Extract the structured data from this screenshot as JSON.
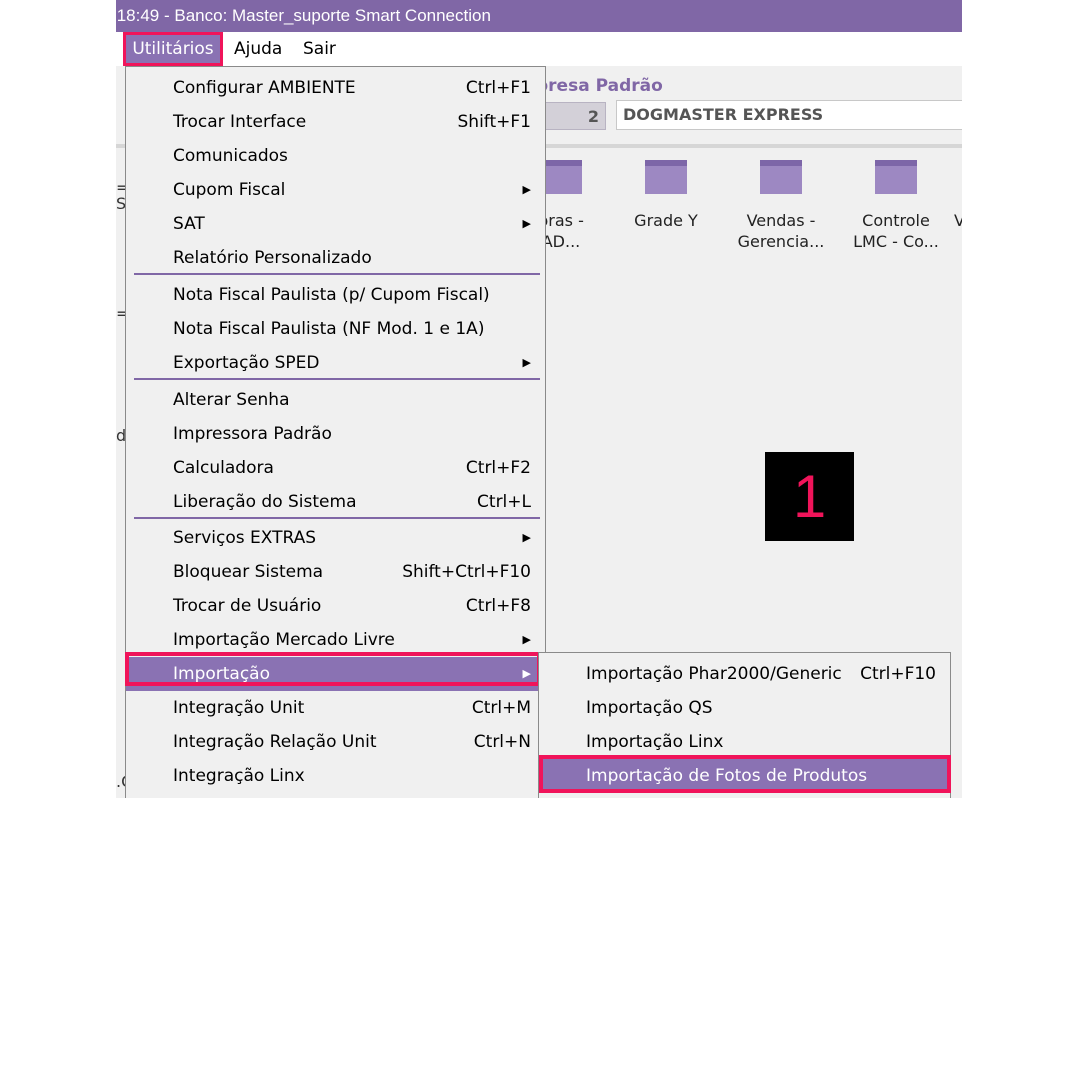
{
  "window": {
    "title": ":18:49 - Banco: Master_suporte Smart Connection"
  },
  "menubar": {
    "items": [
      "Utilitários",
      "Ajuda",
      "Sair"
    ]
  },
  "header": {
    "empresa_label": "presa Padrão",
    "codigo": "2",
    "empresa_nome": "DOGMASTER EXPRESS"
  },
  "shortcuts": [
    {
      "line1": "pras -",
      "line2": "AD..."
    },
    {
      "line1": "Grade Y",
      "line2": ""
    },
    {
      "line1": "Vendas -",
      "line2": "Gerencia..."
    },
    {
      "line1": "Controle",
      "line2": "LMC - Co..."
    },
    {
      "line1": "V",
      "line2": ""
    }
  ],
  "left_fragments": [
    "=",
    "S",
    "=",
    "d",
    ".C"
  ],
  "dropdown": {
    "items": [
      {
        "label": "Configurar AMBIENTE",
        "shortcut": "Ctrl+F1"
      },
      {
        "label": "Trocar Interface",
        "shortcut": "Shift+F1"
      },
      {
        "label": "Comunicados",
        "shortcut": ""
      },
      {
        "label": "Cupom Fiscal",
        "submenu": true
      },
      {
        "label": "SAT",
        "submenu": true
      },
      {
        "label": "Relatório Personalizado",
        "shortcut": ""
      },
      {
        "label": "Nota Fiscal Paulista (p/ Cupom Fiscal)",
        "shortcut": ""
      },
      {
        "label": "Nota Fiscal Paulista (NF Mod. 1 e 1A)",
        "shortcut": ""
      },
      {
        "label": "Exportação SPED",
        "submenu": true
      },
      {
        "label": "Alterar Senha",
        "shortcut": ""
      },
      {
        "label": "Impressora Padrão",
        "shortcut": ""
      },
      {
        "label": "Calculadora",
        "shortcut": "Ctrl+F2"
      },
      {
        "label": "Liberação do Sistema",
        "shortcut": "Ctrl+L"
      },
      {
        "label": "Serviços EXTRAS",
        "submenu": true
      },
      {
        "label": "Bloquear Sistema",
        "shortcut": "Shift+Ctrl+F10"
      },
      {
        "label": "Trocar de Usuário",
        "shortcut": "Ctrl+F8"
      },
      {
        "label": "Importação Mercado Livre",
        "submenu": true
      },
      {
        "label": "Importação",
        "submenu": true,
        "highlighted": true
      },
      {
        "label": "Integração Unit",
        "shortcut": "Ctrl+M"
      },
      {
        "label": "Integração Relação Unit",
        "shortcut": "Ctrl+N"
      },
      {
        "label": "Integração Linx",
        "shortcut": ""
      }
    ]
  },
  "submenu": {
    "items": [
      {
        "label": "Importação Phar2000/Generic",
        "shortcut": "Ctrl+F10"
      },
      {
        "label": "Importação QS",
        "shortcut": ""
      },
      {
        "label": "Importação Linx",
        "shortcut": ""
      },
      {
        "label": "Importação de Fotos de Produtos",
        "shortcut": "",
        "highlighted": true
      }
    ]
  },
  "step_badge": "1",
  "colors": {
    "accent": "#8067a6",
    "highlight": "#8a72b3",
    "callout": "#f0145a"
  }
}
